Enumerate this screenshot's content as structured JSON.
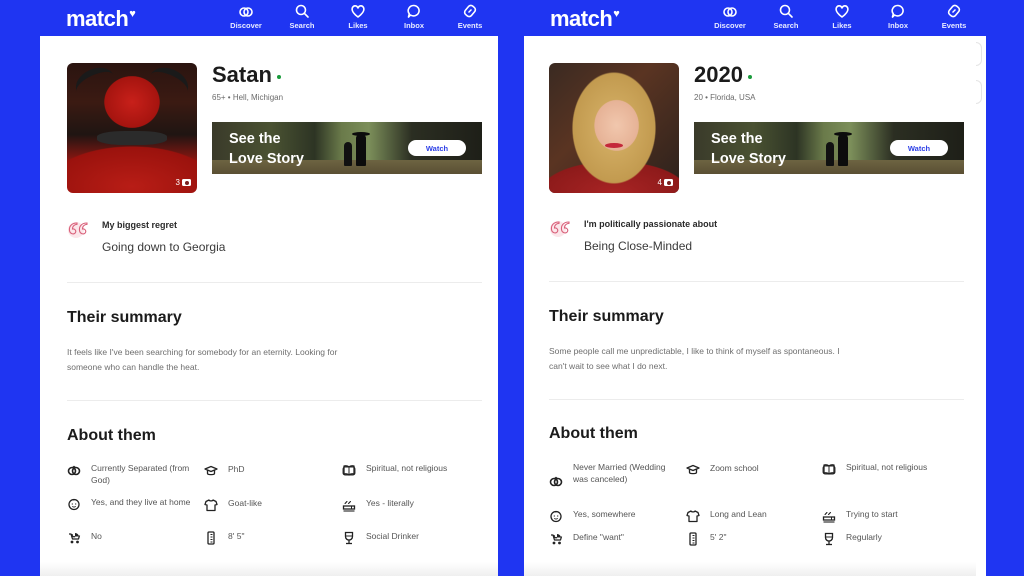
{
  "brand": {
    "logo_text": "match",
    "logo_mark": "♥",
    "accent_color": "#1f35f2",
    "online_color": "#1a9b3c"
  },
  "nav": [
    {
      "label": "Discover",
      "icon": "rings-icon"
    },
    {
      "label": "Search",
      "icon": "search-icon"
    },
    {
      "label": "Likes",
      "icon": "heart-icon"
    },
    {
      "label": "Inbox",
      "icon": "chat-bubble-icon"
    },
    {
      "label": "Events",
      "icon": "ticket-icon"
    }
  ],
  "profiles": [
    {
      "name": "Satan",
      "meta": "65+ • Hell, Michigan",
      "photo_count": "3",
      "banner": {
        "line1": "See the",
        "line2": "Love Story",
        "button": "Watch"
      },
      "prompt": {
        "question": "My biggest regret",
        "answer": "Going down to Georgia"
      },
      "summary_heading": "Their summary",
      "summary_line1": "It feels like I've been searching for somebody for an eternity.  Looking for",
      "summary_line2": "someone who can handle the heat.",
      "about_heading": "About them",
      "attributes": {
        "relationship": "Currently Separated (from God)",
        "education": "PhD",
        "religion": "Spiritual, not religious",
        "kids": "Yes, and they live at home",
        "body_type": "Goat-like",
        "smoking": "Yes - literally",
        "want_kids": "No",
        "height": "8' 5\"",
        "drinking": "Social Drinker"
      }
    },
    {
      "name": "2020",
      "meta": "20 • Florida, USA",
      "photo_count": "4",
      "banner": {
        "line1": "See the",
        "line2": "Love Story",
        "button": "Watch"
      },
      "prompt": {
        "question": "I'm politically passionate about",
        "answer": "Being Close-Minded"
      },
      "summary_heading": "Their summary",
      "summary_line1": "Some people call me unpredictable, I like to think of myself as spontaneous.  I",
      "summary_line2": "can't wait to see what I do next.",
      "about_heading": "About them",
      "attributes": {
        "relationship": "Never Married (Wedding was canceled)",
        "education": "Zoom school",
        "religion": "Spiritual, not religious",
        "kids": "Yes, somewhere",
        "body_type": "Long and Lean",
        "smoking": "Trying to start",
        "want_kids": "Define \"want\"",
        "height": "5' 2\"",
        "drinking": "Regularly"
      }
    }
  ]
}
